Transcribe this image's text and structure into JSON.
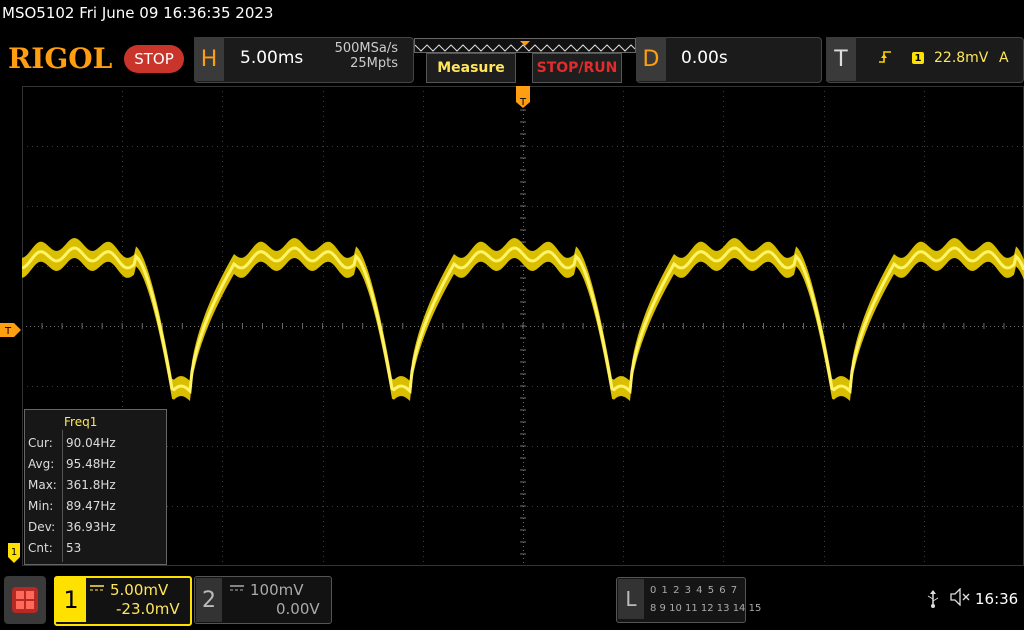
{
  "header": {
    "title": "MSO5102  Fri June 09 16:36:35 2023",
    "logo": "RIGOL",
    "run_status": "STOP"
  },
  "horizontal": {
    "letter": "H",
    "time_scale": "5.00ms",
    "sample_rate": "500MSa/s",
    "memory_depth": "25Mpts"
  },
  "buttons": {
    "measure": "Measure",
    "stop_run": "STOP/RUN"
  },
  "delay": {
    "letter": "D",
    "value": "0.00s"
  },
  "trigger": {
    "letter": "T",
    "source": "1",
    "level": "22.8mV",
    "mode": "A",
    "edge_icon": "rising-edge-icon"
  },
  "markers": {
    "trigger_position": "T",
    "trigger_level": "T",
    "channel1": "1"
  },
  "measurement": {
    "title": "Freq1",
    "rows": [
      {
        "label": "Cur:",
        "value": "90.04Hz"
      },
      {
        "label": "Avg:",
        "value": "95.48Hz"
      },
      {
        "label": "Max:",
        "value": "361.8Hz"
      },
      {
        "label": "Min:",
        "value": "89.47Hz"
      },
      {
        "label": "Dev:",
        "value": "36.93Hz"
      },
      {
        "label": "Cnt:",
        "value": "53"
      }
    ]
  },
  "channel1": {
    "number": "1",
    "scale": "5.00mV",
    "offset": "-23.0mV",
    "coupling_icon": "dc-coupling-icon"
  },
  "channel2": {
    "number": "2",
    "scale": "100mV",
    "offset": "0.00V",
    "coupling_icon": "dc-coupling-icon"
  },
  "logic_analyzer": {
    "letter": "L",
    "row1": "0 1 2 3  4 5 6 7",
    "row2": "8 9 10 11 12 13 14 15"
  },
  "status": {
    "usb_icon": "usb-icon",
    "speaker_icon": "speaker-mute-icon",
    "time": "16:36"
  },
  "colors": {
    "trace": "#ffe100",
    "accent": "#ff9e10",
    "stop": "#c9342b"
  }
}
